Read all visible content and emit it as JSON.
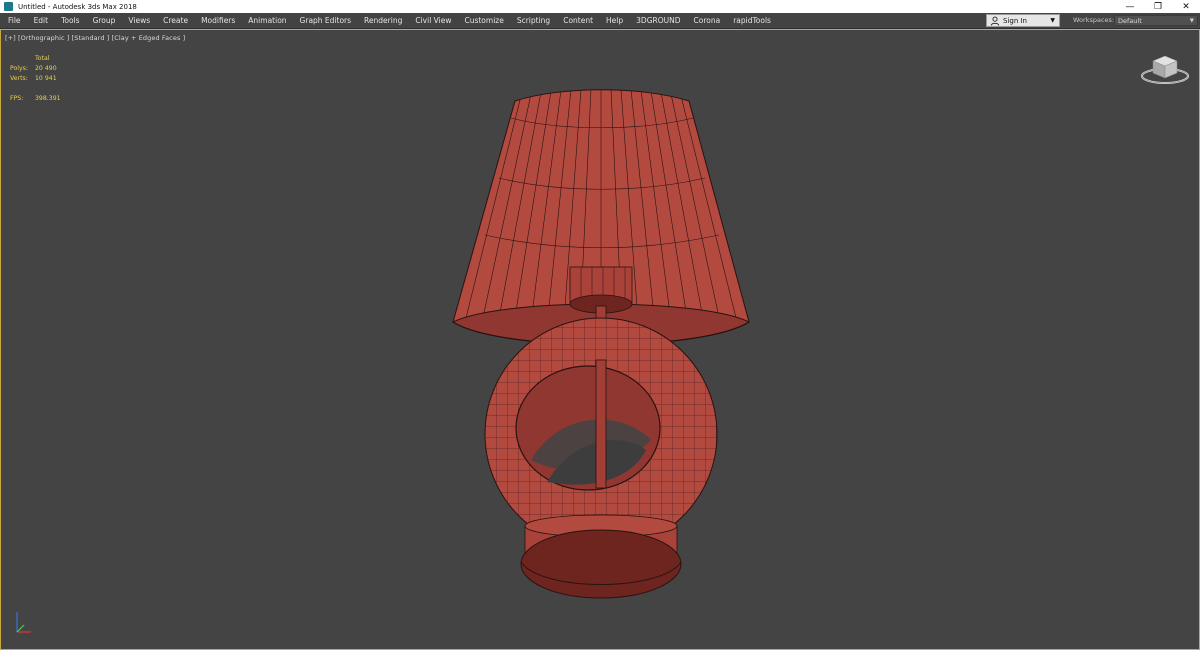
{
  "window": {
    "title": "Untitled - Autodesk 3ds Max 2018",
    "controls": {
      "minimize": "—",
      "restore": "❐",
      "close": "✕"
    }
  },
  "menubar": {
    "items": [
      "File",
      "Edit",
      "Tools",
      "Group",
      "Views",
      "Create",
      "Modifiers",
      "Animation",
      "Graph Editors",
      "Rendering",
      "Civil View",
      "Customize",
      "Scripting",
      "Content",
      "Help",
      "3DGROUND",
      "Corona",
      "rapidTools"
    ],
    "signin_label": "Sign In",
    "workspaces_label": "Workspaces:",
    "workspaces_value": "Default"
  },
  "viewport": {
    "label": "[+] [Orthographic ] [Standard ] [Clay + Edged Faces ]",
    "stats": {
      "header": "Total",
      "polys_label": "Polys:",
      "polys_value": "20 490",
      "verts_label": "Verts:",
      "verts_value": "10 941",
      "fps_label": "FPS:",
      "fps_value": "398.391"
    }
  },
  "colors": {
    "clay": "#b34a40",
    "clay_dark": "#7d2a24",
    "wire": "#2a1210",
    "viewport_bg": "#444444",
    "active_border": "#c8a93c"
  },
  "icons": [
    "app-icon",
    "minimize-icon",
    "restore-icon",
    "close-icon",
    "user-icon",
    "chevron-down-icon",
    "viewcube-icon",
    "axis-tripod-icon"
  ]
}
